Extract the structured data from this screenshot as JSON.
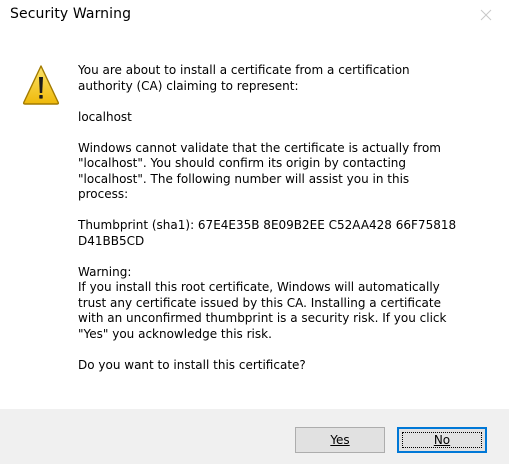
{
  "window": {
    "title": "Security Warning"
  },
  "message": {
    "intro": "You are about to install a certificate from a certification\nauthority (CA) claiming to represent:",
    "subject": "localhost",
    "validation": "Windows cannot validate that the certificate is actually from\n\"localhost\". You should confirm its origin by contacting\n\"localhost\". The following number will assist you in this\nprocess:",
    "thumbprint": "Thumbprint (sha1): 67E4E35B 8E09B2EE C52AA428 66F75818\nD41BB5CD",
    "warning": "Warning:\nIf you install this root certificate, Windows will automatically\ntrust any certificate issued by this CA. Installing a certificate\nwith an unconfirmed thumbprint is a security risk. If you click\n\"Yes\" you acknowledge this risk.",
    "question": "Do you want to install this certificate?"
  },
  "buttons": {
    "yes_label": "Yes",
    "no_label": "No"
  },
  "icons": {
    "warning": "warning-icon",
    "close": "close-icon"
  },
  "colors": {
    "warning_fill": "#f2c40d",
    "warning_stroke": "#b88a00",
    "focus_border": "#0078d7",
    "footer_bg": "#f0f0f0"
  }
}
